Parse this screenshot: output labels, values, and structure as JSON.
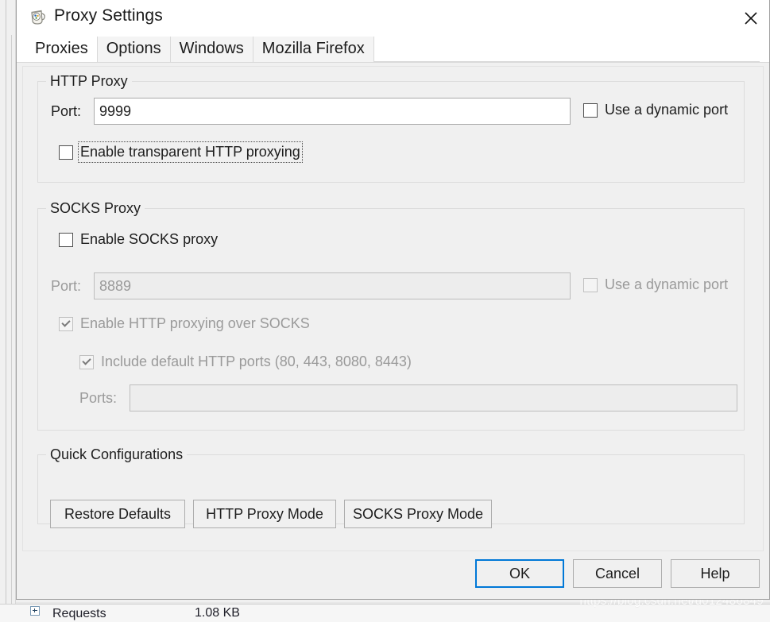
{
  "window": {
    "title": "Proxy Settings",
    "icon": "fiddler-jug-icon",
    "close_label": "✕"
  },
  "tabs": [
    {
      "label": "Proxies",
      "active": true
    },
    {
      "label": "Options",
      "active": false
    },
    {
      "label": "Windows",
      "active": false
    },
    {
      "label": "Mozilla Firefox",
      "active": false
    }
  ],
  "http_proxy": {
    "legend": "HTTP Proxy",
    "port_label": "Port:",
    "port_value": "9999",
    "dynamic_port_label": "Use a dynamic port",
    "dynamic_port_checked": false,
    "transparent_label": "Enable transparent HTTP proxying",
    "transparent_checked": false
  },
  "socks_proxy": {
    "legend": "SOCKS Proxy",
    "enable_label": "Enable SOCKS proxy",
    "enable_checked": false,
    "port_label": "Port:",
    "port_value": "8889",
    "dynamic_port_label": "Use a dynamic port",
    "dynamic_port_checked": false,
    "http_over_socks_label": "Enable HTTP proxying over SOCKS",
    "http_over_socks_checked": true,
    "include_default_ports_label": "Include default HTTP ports (80, 443, 8080, 8443)",
    "include_default_ports_checked": true,
    "ports_label": "Ports:",
    "ports_value": ""
  },
  "quick_configurations": {
    "legend": "Quick Configurations",
    "restore_defaults": "Restore Defaults",
    "http_proxy_mode": "HTTP Proxy Mode",
    "socks_proxy_mode": "SOCKS Proxy Mode"
  },
  "dialog_buttons": {
    "ok": "OK",
    "cancel": "Cancel",
    "help": "Help"
  },
  "background": {
    "row_label": "Requests",
    "row_size": "1.08 KB",
    "watermark": "https://blog.csdn.net/u012486849"
  },
  "colors": {
    "accent": "#0078d7",
    "dialog_bg": "#f0f0f0",
    "titlebar_bg": "#ffffff",
    "text": "#1e1e1e",
    "disabled_text": "#9a9a9a"
  }
}
